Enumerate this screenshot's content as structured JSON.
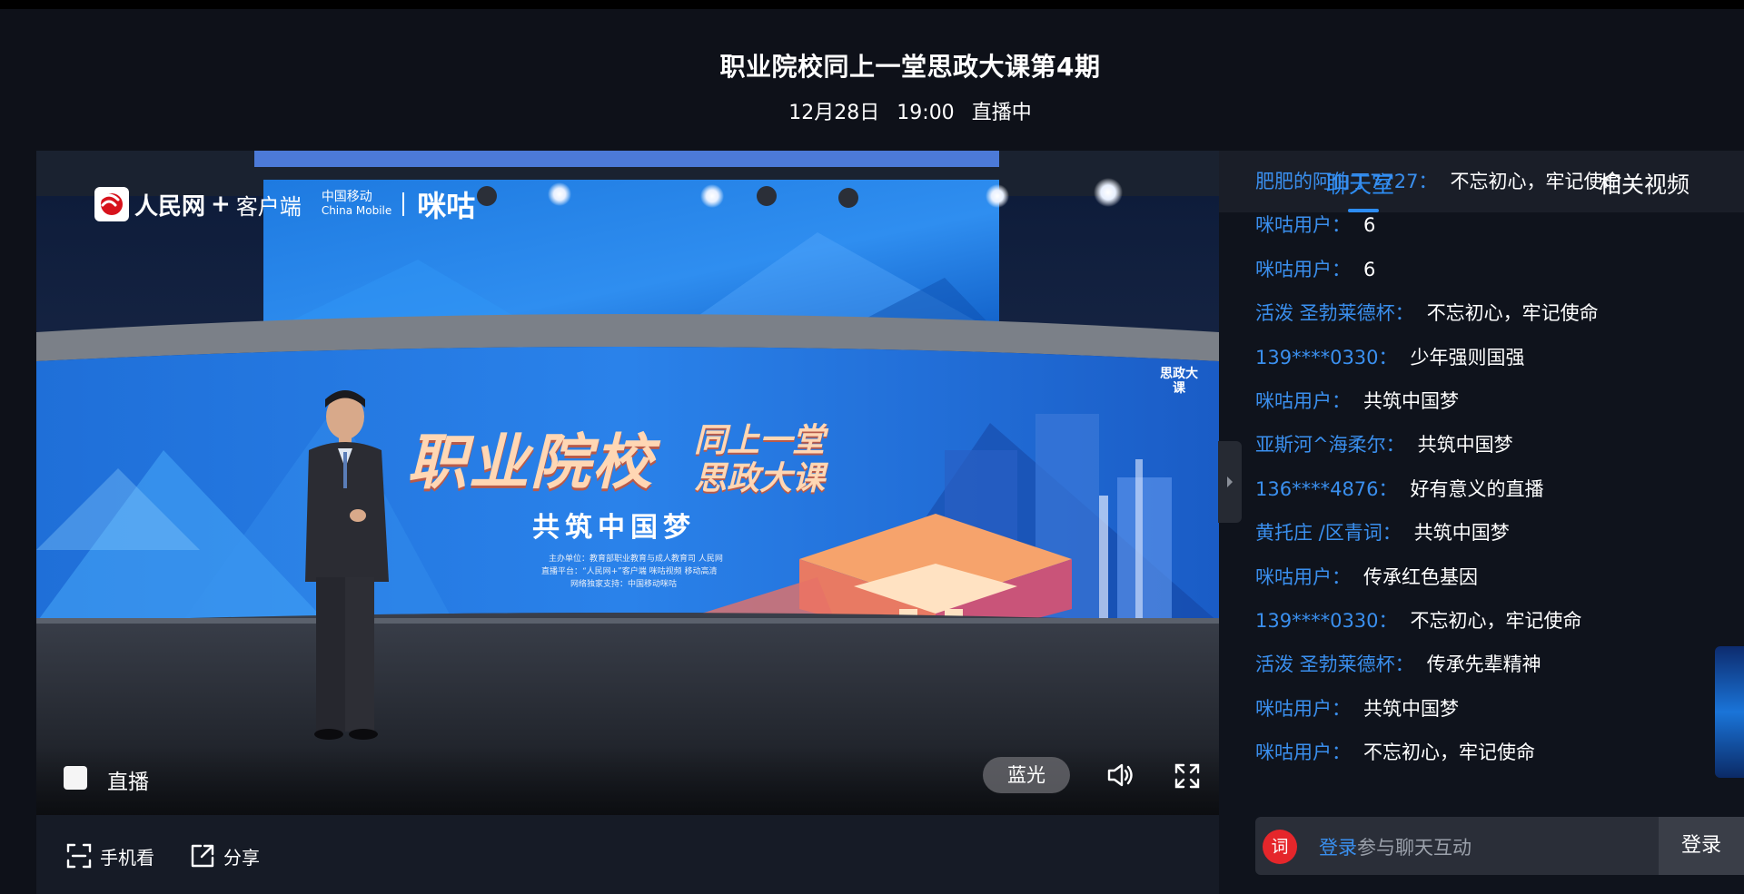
{
  "header": {
    "title": "职业院校同上一堂思政大课第4期",
    "date": "12月28日",
    "time": "19:00",
    "status": "直播中"
  },
  "video": {
    "logo_rmw": "人民网",
    "logo_rmw_plus": "+",
    "logo_client": "客户端",
    "logo_cm_cn": "中国移动",
    "logo_cm_en": "China Mobile",
    "logo_migu": "咪咕",
    "screen_title_1": "职业院校",
    "screen_title_2a": "同上一堂",
    "screen_title_2b": "思政大课",
    "screen_slogan": "共筑中国梦",
    "screen_host": "主办单位：教育部职业教育与成人教育司 人民网",
    "screen_platform": "直播平台：“人民网+”客户端 咪咕视频 移动高清",
    "screen_support": "网络独家支持：中国移动咪咕",
    "screen_badge": "思政大课",
    "live_label": "直播",
    "quality": "蓝光"
  },
  "under_bar": {
    "phone_watch": "手机看",
    "share": "分享"
  },
  "chat": {
    "tab_chat": "聊天室",
    "tab_related": "相关视频",
    "messages": [
      {
        "user": "肥肥的阿伯丁7727：",
        "text": "不忘初心，牢记使命"
      },
      {
        "user": "咪咕用户：",
        "text": "6"
      },
      {
        "user": "咪咕用户：",
        "text": "6"
      },
      {
        "user": "活泼 圣勃莱德杯：",
        "text": "不忘初心，牢记使命"
      },
      {
        "user": "139****0330：",
        "text": "少年强则国强"
      },
      {
        "user": "咪咕用户：",
        "text": "共筑中国梦"
      },
      {
        "user": "亚斯河^海柔尔：",
        "text": "共筑中国梦"
      },
      {
        "user": "136****4876：",
        "text": "好有意义的直播"
      },
      {
        "user": "黄托庄 /区青词：",
        "text": "共筑中国梦"
      },
      {
        "user": "咪咕用户：",
        "text": "传承红色基因"
      },
      {
        "user": "139****0330：",
        "text": "不忘初心，牢记使命"
      },
      {
        "user": "活泼 圣勃莱德杯：",
        "text": "传承先辈精神"
      },
      {
        "user": "咪咕用户：",
        "text": "共筑中国梦"
      },
      {
        "user": "咪咕用户：",
        "text": "不忘初心，牢记使命"
      }
    ],
    "input_icon": "词",
    "input_link": "登录",
    "input_text": "参与聊天互动",
    "login_button": "登录"
  },
  "colors": {
    "accent": "#2d8df4",
    "username": "#3a8fee",
    "brand_red": "#e5262b"
  }
}
